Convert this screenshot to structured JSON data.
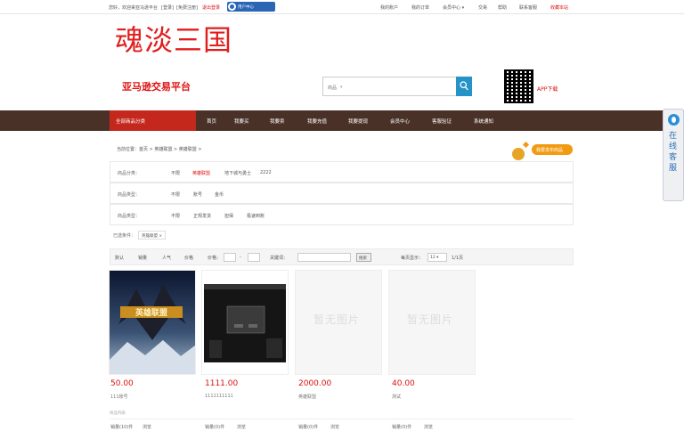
{
  "topbar": {
    "greeting": "您好，欢迎来亚马逊平台",
    "login": "[登录]",
    "register": "[免费注册]",
    "red_link": "退出登录",
    "app_btn": "用户中心",
    "links": [
      "我的账户",
      "我的订单",
      "会员中心 ▾",
      "交易",
      "帮助",
      "联系客服",
      "收藏本站"
    ]
  },
  "header": {
    "logo": "魂淡三国",
    "slogan": "亚马逊交易平台",
    "search_placeholder": "商品",
    "search_caret": "▾",
    "app_label": "APP下载"
  },
  "nav": {
    "category": "全部商品分类",
    "items": [
      "首页",
      "我要买",
      "我要卖",
      "我要充值",
      "我要提现",
      "会员中心",
      "客服验证",
      "系统通知"
    ]
  },
  "sidefloat": {
    "text": "在线客服"
  },
  "breadcrumb": "当前位置：首页 > 英雄联盟 > 英雄联盟 >",
  "publish": "我要发布商品",
  "filters": [
    {
      "label": "商品分类：",
      "options": [
        "不限",
        "英雄联盟",
        "地下城与勇士",
        "2222"
      ],
      "active": 1
    },
    {
      "label": "商品类型：",
      "options": [
        "不限",
        "账号",
        "金币"
      ],
      "active": -1
    },
    {
      "label": "商品类型：",
      "options": [
        "不限",
        "正规发货",
        "担保",
        "极速到账"
      ],
      "active": -1
    }
  ],
  "chosen": {
    "label": "已选条件：",
    "tag": "英雄联盟 ×"
  },
  "sortbar": {
    "items": [
      "默认",
      "销量",
      "人气",
      "价格",
      "价格："
    ],
    "dash": "-",
    "keyword": "关键词：",
    "search_btn": "搜索",
    "per_page": "每页显示：",
    "per_page_value": "12 ▾",
    "page_info": "1/1页"
  },
  "products": [
    {
      "price": "50.00",
      "sub": "111账号",
      "type": "image-lol",
      "foot": "销量(10)件",
      "foot2": "浏览"
    },
    {
      "price": "1111.00",
      "sub": "1111111111",
      "type": "image-screen",
      "foot": "销量(0)件",
      "foot2": "浏览"
    },
    {
      "price": "2000.00",
      "sub": "英雄联盟",
      "type": "no-image",
      "noimg": "暂无图片",
      "foot": "销量(0)件",
      "foot2": "浏览"
    },
    {
      "price": "40.00",
      "sub": "测试",
      "type": "no-image",
      "noimg": "暂无图片",
      "foot": "销量(0)件",
      "foot2": "浏览"
    }
  ],
  "section_note": "商品列表",
  "colors": {
    "brand_red": "#e01e1e",
    "nav_bg": "#4a3128",
    "nav_active": "#c4281d",
    "search_blue": "#2593c8"
  }
}
